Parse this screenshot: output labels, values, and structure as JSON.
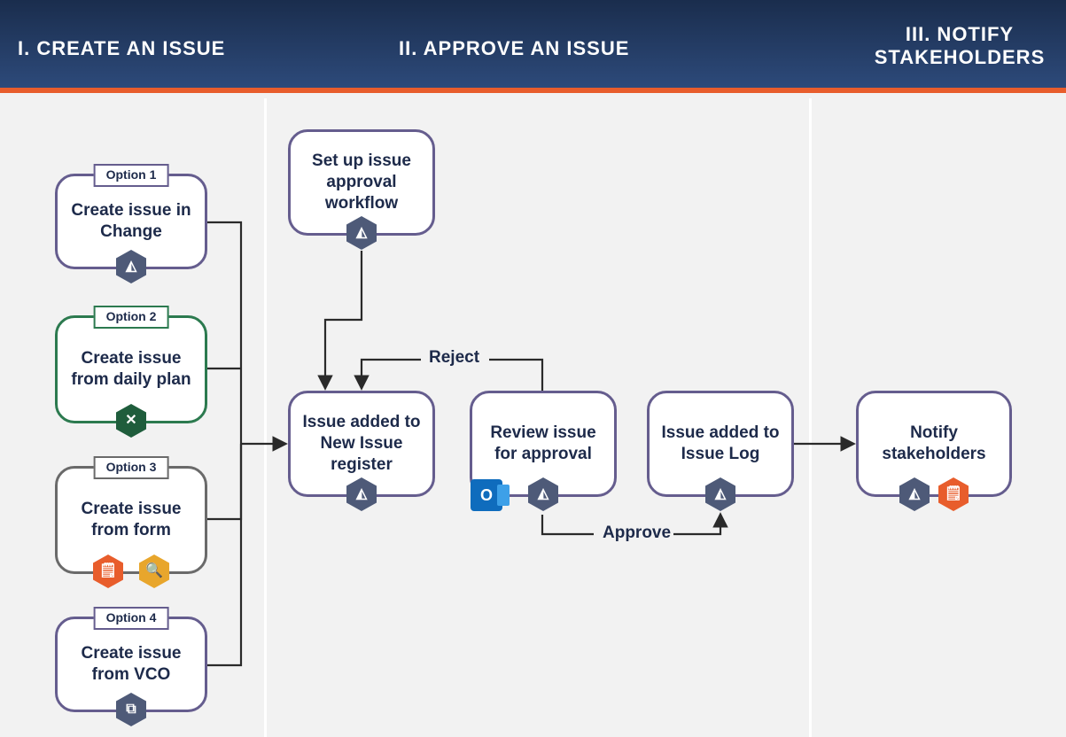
{
  "header": {
    "section1": "I. CREATE AN ISSUE",
    "section2": "II. APPROVE AN ISSUE",
    "section3": "III. NOTIFY STAKEHOLDERS"
  },
  "options": {
    "opt1": {
      "tag": "Option 1",
      "label": "Create issue in Change"
    },
    "opt2": {
      "tag": "Option 2",
      "label": "Create issue from daily plan"
    },
    "opt3": {
      "tag": "Option 3",
      "label": "Create issue from form"
    },
    "opt4": {
      "tag": "Option 4",
      "label": "Create issue from VCO"
    }
  },
  "nodes": {
    "setup": "Set up issue approval workflow",
    "added": "Issue added to New Issue register",
    "review": "Review issue for approval",
    "log": "Issue added to Issue Log",
    "notify": "Notify stakeholders"
  },
  "edges": {
    "reject": "Reject",
    "approve": "Approve"
  },
  "icons": {
    "triangle": "◭",
    "tools": "✕",
    "clipboard": "🗒",
    "search": "🔍",
    "copy": "⧉",
    "outlook": "O"
  }
}
